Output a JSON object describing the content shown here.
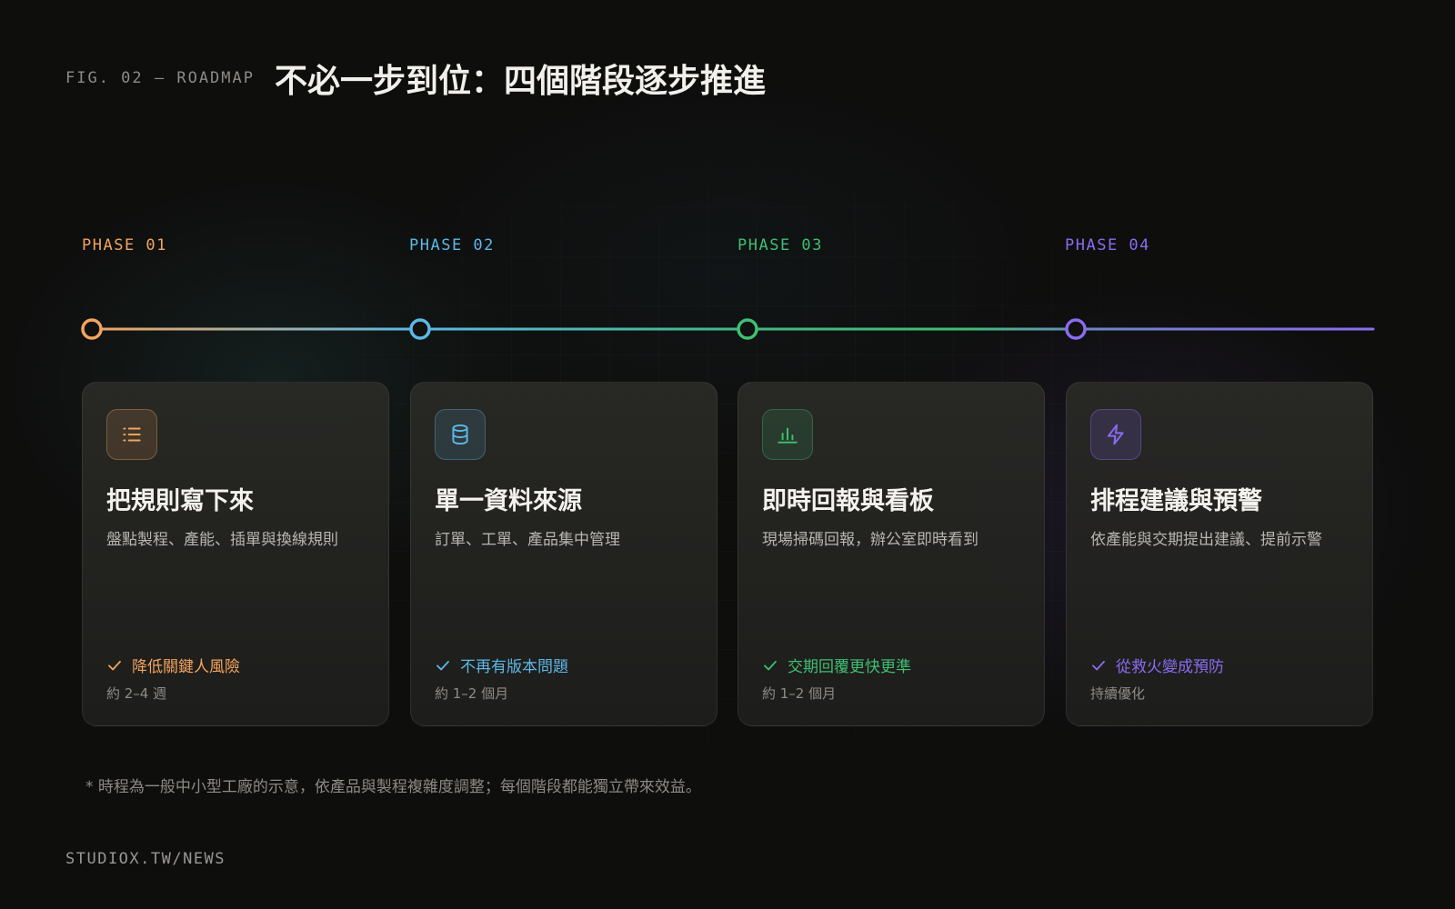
{
  "header": {
    "fig_label": "FIG. 02 — ROADMAP",
    "title": "不必一步到位：四個階段逐步推進"
  },
  "phases": [
    {
      "label": "PHASE 01",
      "color": "#f2a45f",
      "icon": "list-icon",
      "title": "把規則寫下來",
      "desc": "盤點製程、產能、插單與換線規則",
      "benefit": "降低關鍵人風險",
      "duration": "約 2–4 週"
    },
    {
      "label": "PHASE 02",
      "color": "#5cb8e6",
      "icon": "database-icon",
      "title": "單一資料來源",
      "desc": "訂單、工單、產品集中管理",
      "benefit": "不再有版本問題",
      "duration": "約 1–2 個月"
    },
    {
      "label": "PHASE 03",
      "color": "#3fbf72",
      "icon": "bar-chart-icon",
      "title": "即時回報與看板",
      "desc": "現場掃碼回報，辦公室即時看到",
      "benefit": "交期回覆更快更準",
      "duration": "約 1–2 個月"
    },
    {
      "label": "PHASE 04",
      "color": "#8b6cf0",
      "icon": "lightning-icon",
      "title": "排程建議與預警",
      "desc": "依產能與交期提出建議、提前示警",
      "benefit": "從救火變成預防",
      "duration": "持續優化"
    }
  ],
  "footnote": "* 時程為一般中小型工廠的示意，依產品與製程複雜度調整；每個階段都能獨立帶來效益。",
  "footer": {
    "site": "STUDIOX.TW/NEWS"
  }
}
